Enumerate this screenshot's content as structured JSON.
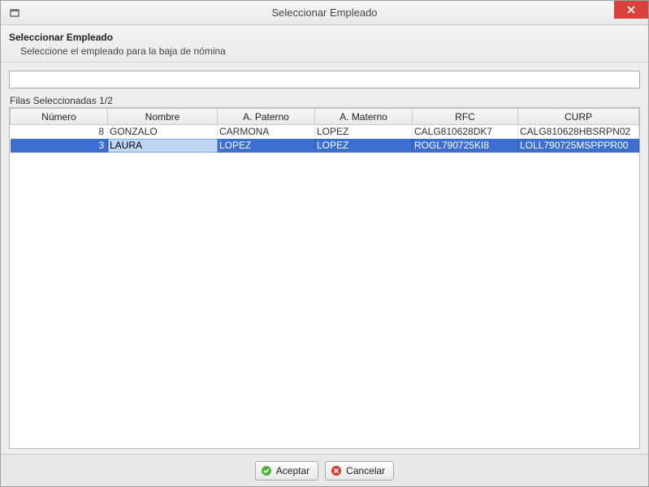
{
  "window": {
    "title": "Seleccionar Empleado"
  },
  "header": {
    "title": "Seleccionar Empleado",
    "subtitle": "Seleccione el empleado para la baja de nómina"
  },
  "search": {
    "value": ""
  },
  "filas_label": "Filas Seleccionadas 1/2",
  "grid": {
    "columns": [
      "Número",
      "Nombre",
      "A. Paterno",
      "A. Materno",
      "RFC",
      "CURP"
    ],
    "rows": [
      {
        "numero": "8",
        "nombre": "GONZALO",
        "apaterno": "CARMONA",
        "amaterno": "LOPEZ",
        "rfc": "CALG810628DK7",
        "curp": "CALG810628HBSRPN02",
        "selected": false
      },
      {
        "numero": "3",
        "nombre": "LAURA",
        "apaterno": "LOPEZ",
        "amaterno": "LOPEZ",
        "rfc": "ROGL790725KI8",
        "curp": "LOLL790725MSPPPR00",
        "selected": true,
        "focus_col": "nombre"
      }
    ]
  },
  "buttons": {
    "accept": "Aceptar",
    "cancel": "Cancelar"
  }
}
